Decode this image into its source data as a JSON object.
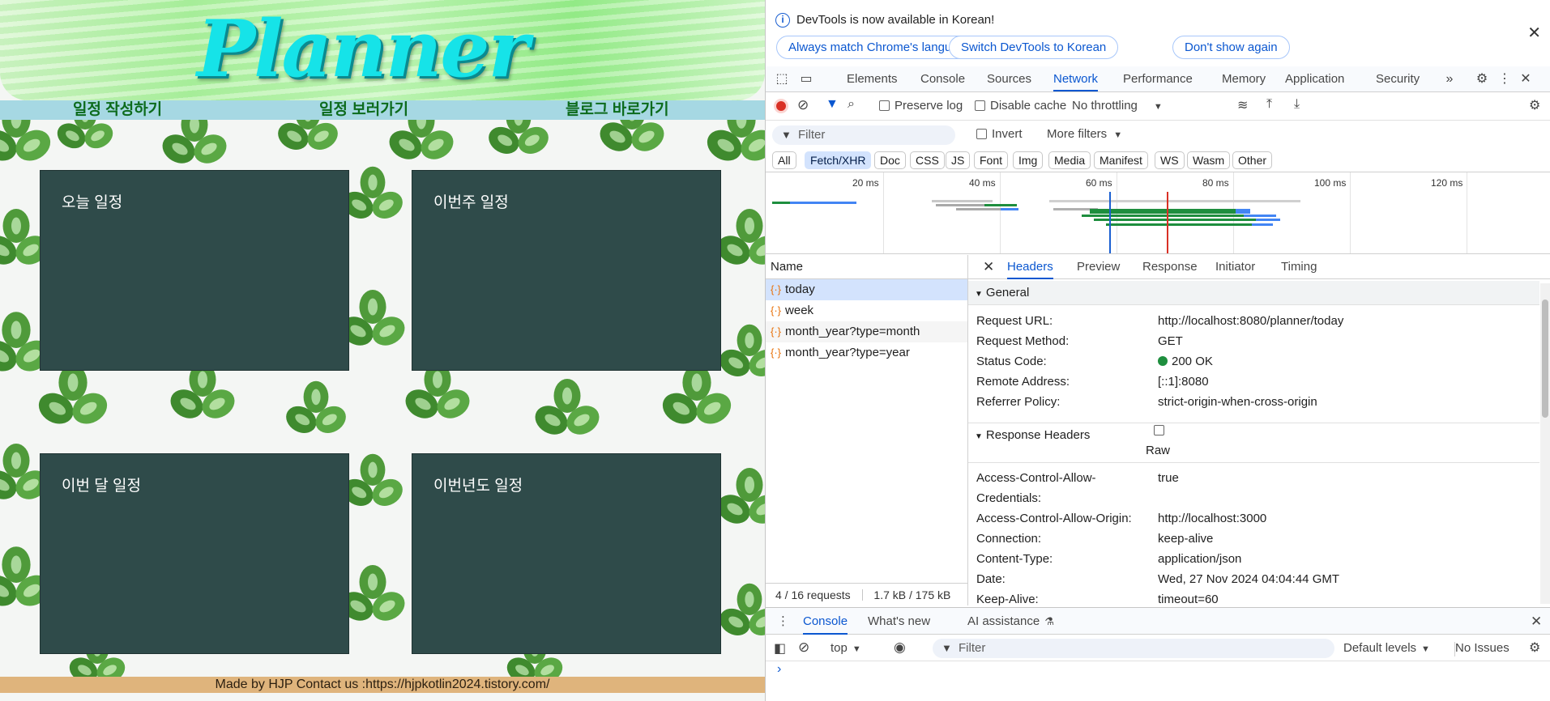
{
  "planner": {
    "title": "Planner",
    "nav": [
      "일정 작성하기",
      "일정 보러가기",
      "블로그 바로가기"
    ],
    "cards": [
      "오늘 일정",
      "이번주 일정",
      "이번 달 일정",
      "이번년도 일정"
    ],
    "footer": "Made by HJP Contact us :https://hjpkotlin2024.tistory.com/"
  },
  "devtools": {
    "infobar": {
      "message": "DevTools is now available in Korean!",
      "buttons": [
        "Always match Chrome's language",
        "Switch DevTools to Korean",
        "Don't show again"
      ]
    },
    "tabs": [
      "Elements",
      "Console",
      "Sources",
      "Network",
      "Performance",
      "Memory",
      "Application",
      "Security"
    ],
    "active_tab": "Network",
    "toolbar": {
      "preserve_log": "Preserve log",
      "disable_cache": "Disable cache",
      "throttling": "No throttling"
    },
    "filter": {
      "placeholder": "Filter",
      "invert": "Invert",
      "more_filters": "More filters"
    },
    "types": [
      "All",
      "Fetch/XHR",
      "Doc",
      "CSS",
      "JS",
      "Font",
      "Img",
      "Media",
      "Manifest",
      "WS",
      "Wasm",
      "Other"
    ],
    "selected_type": "Fetch/XHR",
    "timeline_ticks": [
      "20 ms",
      "40 ms",
      "60 ms",
      "80 ms",
      "100 ms",
      "120 ms"
    ],
    "name_header": "Name",
    "requests": [
      "today",
      "week",
      "month_year?type=month",
      "month_year?type=year"
    ],
    "summary": {
      "requests": "4 / 16 requests",
      "transferred": "1.7 kB / 175 kB"
    },
    "detail_tabs": [
      "Headers",
      "Preview",
      "Response",
      "Initiator",
      "Timing"
    ],
    "general": {
      "label": "General",
      "rows": [
        {
          "k": "Request URL:",
          "v": "http://localhost:8080/planner/today"
        },
        {
          "k": "Request Method:",
          "v": "GET"
        },
        {
          "k": "Status Code:",
          "v": "200 OK"
        },
        {
          "k": "Remote Address:",
          "v": "[::1]:8080"
        },
        {
          "k": "Referrer Policy:",
          "v": "strict-origin-when-cross-origin"
        }
      ]
    },
    "response_headers": {
      "label": "Response Headers",
      "raw": "Raw",
      "rows": [
        {
          "k": "Access-Control-Allow-",
          "k2": "Credentials:",
          "v": "true"
        },
        {
          "k": "Access-Control-Allow-Origin:",
          "v": "http://localhost:3000"
        },
        {
          "k": "Connection:",
          "v": "keep-alive"
        },
        {
          "k": "Content-Type:",
          "v": "application/json"
        },
        {
          "k": "Date:",
          "v": "Wed, 27 Nov 2024 04:04:44 GMT"
        },
        {
          "k": "Keep-Alive:",
          "v": "timeout=60"
        }
      ]
    },
    "drawer": {
      "tabs": [
        "Console",
        "What's new",
        "AI assistance"
      ],
      "context": "top",
      "filter": "Filter",
      "levels": "Default levels",
      "issues": "No Issues",
      "prompt": "›"
    },
    "colors": {
      "accent": "#0b57d0",
      "status_ok": "#1e8e3e"
    }
  }
}
